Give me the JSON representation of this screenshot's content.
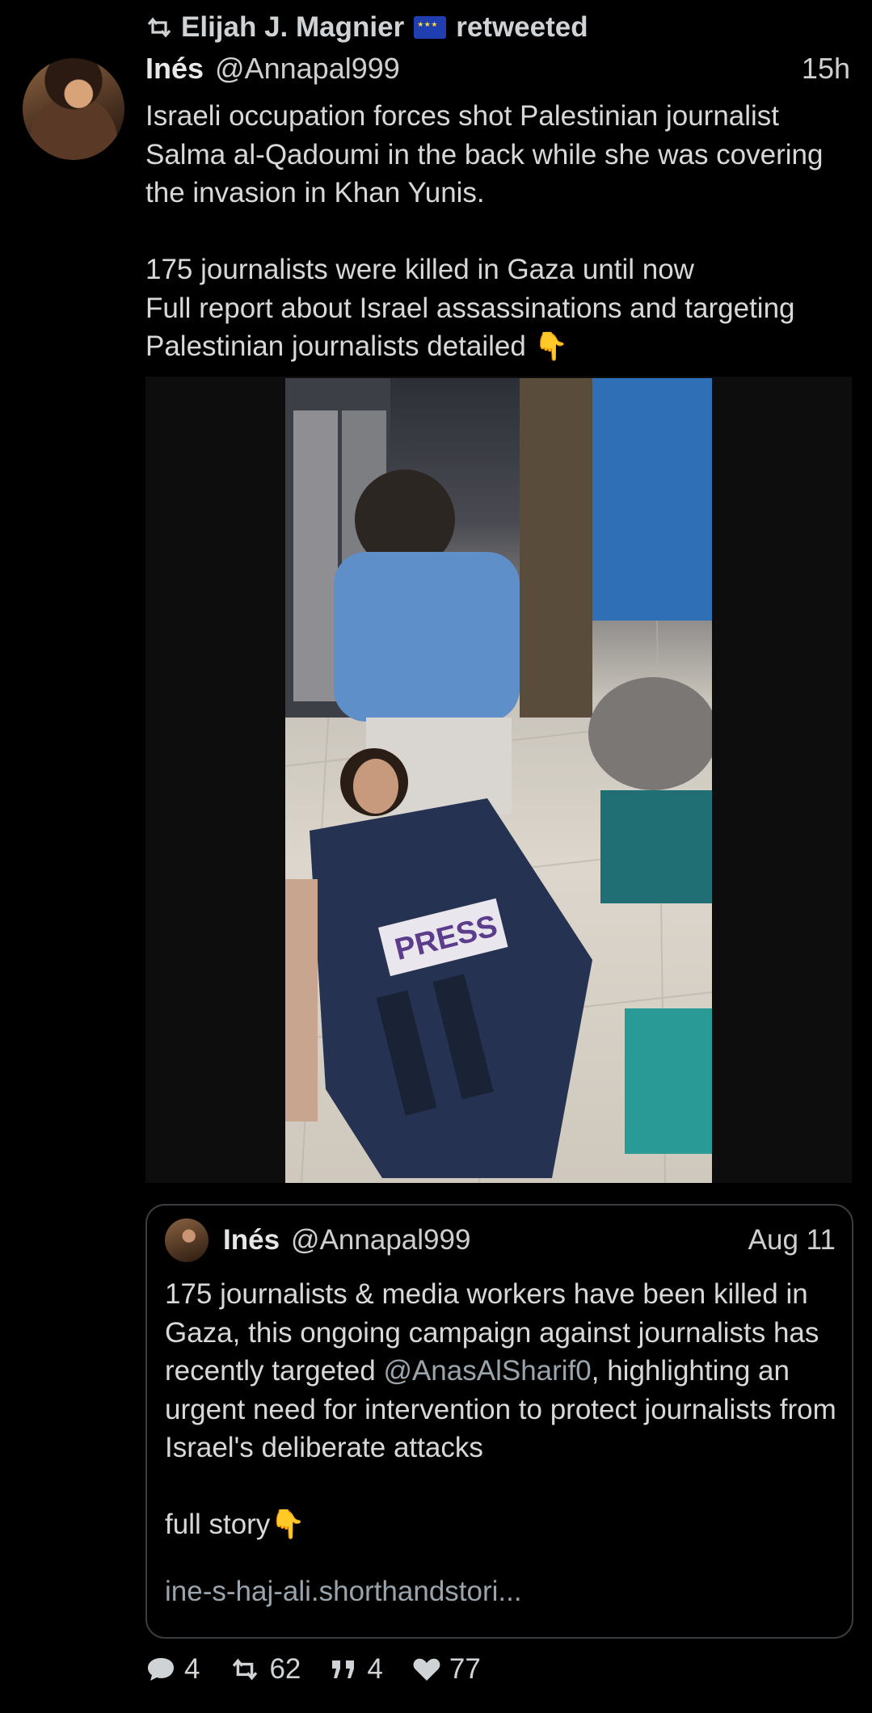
{
  "retweet_bar": {
    "retweeter": "Elijah J. Magnier",
    "action": "retweeted"
  },
  "tweet": {
    "author_name": "Inés",
    "author_handle": "@Annapal999",
    "time": "15h",
    "text": "Israeli occupation forces shot Palestinian journalist Salma al-Qadoumi in the back while she was covering the invasion in Khan Yunis.\n\n175 journalists were killed in Gaza until now\nFull report about Israel assassinations and targeting Palestinian journalists detailed",
    "text_emoji": "👇",
    "image_vest_label": "PRESS"
  },
  "quoted_tweet": {
    "author_name": "Inés",
    "author_handle": "@Annapal999",
    "date": "Aug 11",
    "text_before_mention": "175 journalists & media workers have been killed in Gaza, this ongoing campaign against journalists has recently targeted ",
    "mention": "@AnasAlSharif0",
    "text_after_mention": ", highlighting an urgent need for intervention to protect journalists from Israel's deliberate attacks\n\nfull story",
    "text_emoji": "👇",
    "link": "ine-s-haj-ali.shorthandstori..."
  },
  "actions": {
    "replies": "4",
    "retweets": "62",
    "quotes": "4",
    "likes": "77"
  },
  "colors": {
    "background": "#000000",
    "border": "#3a3d40",
    "link": "#9aa4ad"
  },
  "icons": [
    "retweet-icon",
    "eu-flag-icon",
    "reply-icon",
    "quote-icon",
    "heart-icon"
  ]
}
